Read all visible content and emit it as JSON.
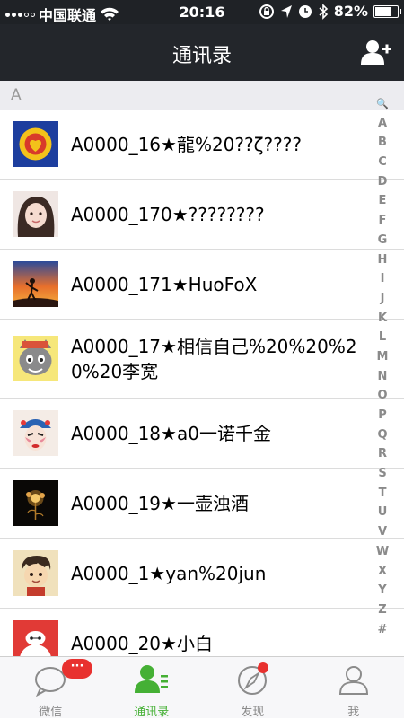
{
  "status_bar": {
    "carrier": "中国联通",
    "time": "20:16",
    "battery_text": "82%",
    "battery_level": 0.82
  },
  "nav": {
    "title": "通讯录",
    "add_icon": "add-contact-icon"
  },
  "section": {
    "letter": "A"
  },
  "contacts": [
    {
      "name": "A0000_16★龍%20??ζ????",
      "avatar": "logo-avatar"
    },
    {
      "name": "A0000_170★????????",
      "avatar": "girl-photo-avatar"
    },
    {
      "name": "A0000_171★HuoFoX",
      "avatar": "sunset-silhouette-avatar"
    },
    {
      "name": "A0000_17★相信自己%20%20%20%20李宽",
      "avatar": "cartoon-wolf-avatar"
    },
    {
      "name": "A0000_18★a0一诺千金",
      "avatar": "opera-mask-avatar"
    },
    {
      "name": "A0000_19★一壶浊酒",
      "avatar": "golden-flower-avatar"
    },
    {
      "name": "A0000_1★yan%20jun",
      "avatar": "cartoon-boy-avatar"
    },
    {
      "name": "A0000_20★小白",
      "avatar": "baymax-avatar"
    }
  ],
  "index_letters": [
    "🔍",
    "A",
    "B",
    "C",
    "D",
    "E",
    "F",
    "G",
    "H",
    "I",
    "J",
    "K",
    "L",
    "M",
    "N",
    "O",
    "P",
    "Q",
    "R",
    "S",
    "T",
    "U",
    "V",
    "W",
    "X",
    "Y",
    "Z",
    "#"
  ],
  "tabs": [
    {
      "label": "微信",
      "icon": "chat-bubble-icon",
      "badge": "···"
    },
    {
      "label": "通讯录",
      "icon": "contacts-icon",
      "active": true
    },
    {
      "label": "发现",
      "icon": "compass-icon",
      "dot": true
    },
    {
      "label": "我",
      "icon": "person-icon"
    }
  ],
  "colors": {
    "nav_bg": "#23262b",
    "accent_green": "#45b035",
    "badge_red": "#e8312f"
  }
}
